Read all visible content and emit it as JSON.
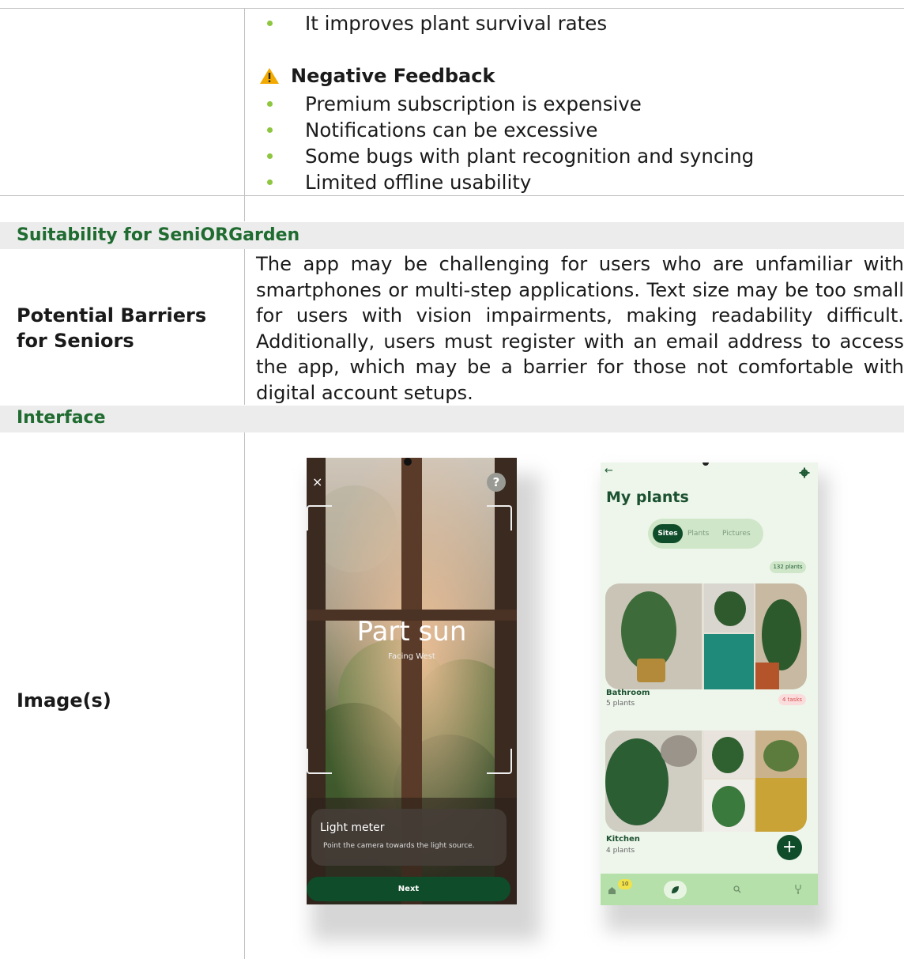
{
  "positive_tail": [
    "It improves plant survival rates"
  ],
  "negative": {
    "heading": "Negative Feedback",
    "items": [
      "Premium subscription is expensive",
      "Notifications can be excessive",
      "Some bugs with plant recognition and syncing",
      "Limited offline usability"
    ]
  },
  "suitability": {
    "heading": "Suitability for SeniORGarden",
    "barrier_label": "Potential Barriers for Seniors",
    "barrier_text": "The app may be challenging for users who are unfamiliar with smartphones or multi-step applications. Text size may be too small for users with vision impairments, making readability difficult. Additionally, users must register with an email address to access the app, which may be a barrier for those not comfortable with digital account setups."
  },
  "interface": {
    "heading": "Interface",
    "images_label": "Image(s)"
  },
  "screen1": {
    "title": "Part sun",
    "subtitle": "Facing West",
    "card_title": "Light meter",
    "card_text": "Point the camera towards the light source.",
    "next_label": "Next",
    "close_glyph": "×",
    "help_glyph": "?"
  },
  "screen2": {
    "back_glyph": "←",
    "title": "My plants",
    "tabs": [
      "Sites",
      "Plants",
      "Pictures"
    ],
    "count_badge": "132 plants",
    "sites": [
      {
        "name": "Bathroom",
        "count": "5 plants",
        "tasks": "4 tasks"
      },
      {
        "name": "Kitchen",
        "count": "4 plants"
      }
    ],
    "nav_badge": "10",
    "fab_glyph": "+"
  },
  "colors": {
    "accent_green": "#1f6b30",
    "bullet_green": "#8dc63f",
    "band_gray": "#ececec",
    "app_dark_green": "#0f4d2a",
    "app_light_green": "#d7ecd2",
    "nav_green": "#b5e0a9"
  }
}
